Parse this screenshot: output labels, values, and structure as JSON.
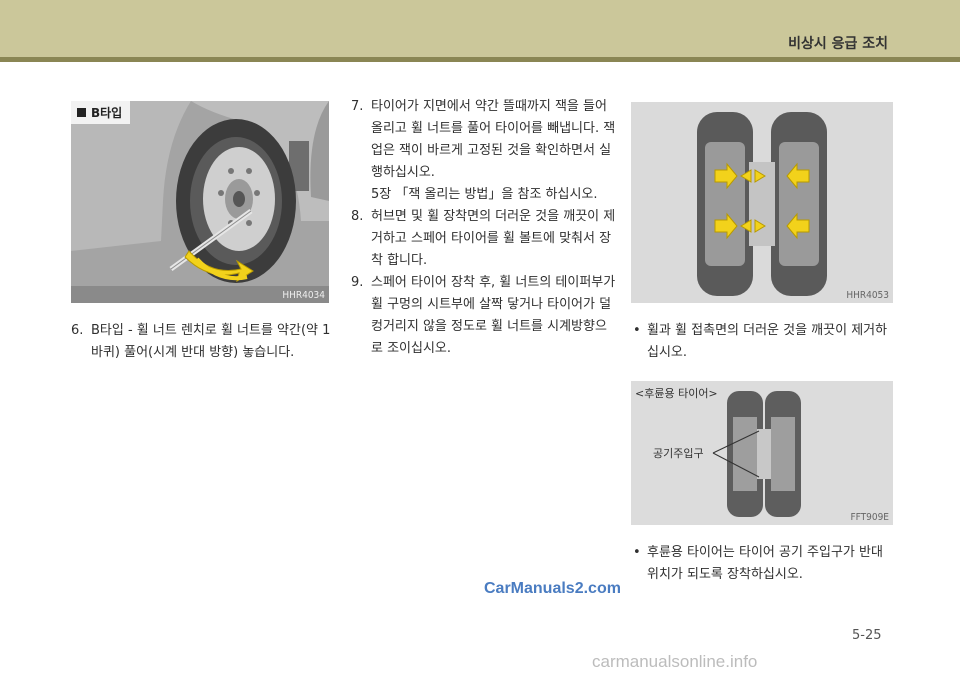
{
  "header": {
    "title": "비상시 응급 조치"
  },
  "figures": {
    "tire_change": {
      "badge": "B타입",
      "code": "HHR4034"
    },
    "contact_surface": {
      "code": "HHR4053"
    },
    "rear_tire": {
      "caption": "<후륜용 타이어>",
      "valve_label": "공기주입구",
      "code": "FFT909E"
    }
  },
  "steps": [
    {
      "num": "6.",
      "lines": [
        "B타입 - 휠 너트 렌치로 휠 너트를 약간(약 1",
        "바퀴) 풀어(시계 반대 방향) 놓습니다."
      ]
    },
    {
      "num": "7.",
      "lines": [
        "타이어가 지면에서 약간 뜰때까지 잭을 들어",
        "올리고 휠 너트를 풀어 타이어를 빼냅니다. 잭",
        "업은 잭이 바르게 고정된 것을 확인하면서 실",
        "행하십시오.",
        "5장 「잭 올리는 방법」을 참조 하십시오."
      ]
    },
    {
      "num": "8.",
      "lines": [
        "허브면 및 휠 장착면의 더러운 것을 깨끗이 제",
        "거하고 스페어 타이어를 휠 볼트에 맞춰서 장",
        "착 합니다."
      ]
    },
    {
      "num": "9.",
      "lines": [
        "스페어 타이어 장착 후, 휠 너트의 테이퍼부가",
        "휠 구멍의 시트부에 살짝 닿거나 타이어가 덜",
        "컹거리지 않을 정도로 휠 너트를 시계방향으",
        "로 조이십시오."
      ]
    }
  ],
  "notes": [
    {
      "bullet": "•",
      "lines": [
        "휠과 휠 접촉면의 더러운 것을 깨끗이 제거하",
        "십시오."
      ]
    },
    {
      "bullet": "•",
      "lines": [
        "후륜용 타이어는 타이어 공기 주입구가 반대",
        "위치가 되도록 장착하십시오."
      ]
    }
  ],
  "watermark": "CarManuals2.com",
  "footer_mark": "carmanualsonline.info",
  "page_number": "5-25",
  "colors": {
    "header_band": "#cbc79a",
    "header_rule": "#8a8654",
    "arrow_yellow": "#f2d21b"
  }
}
